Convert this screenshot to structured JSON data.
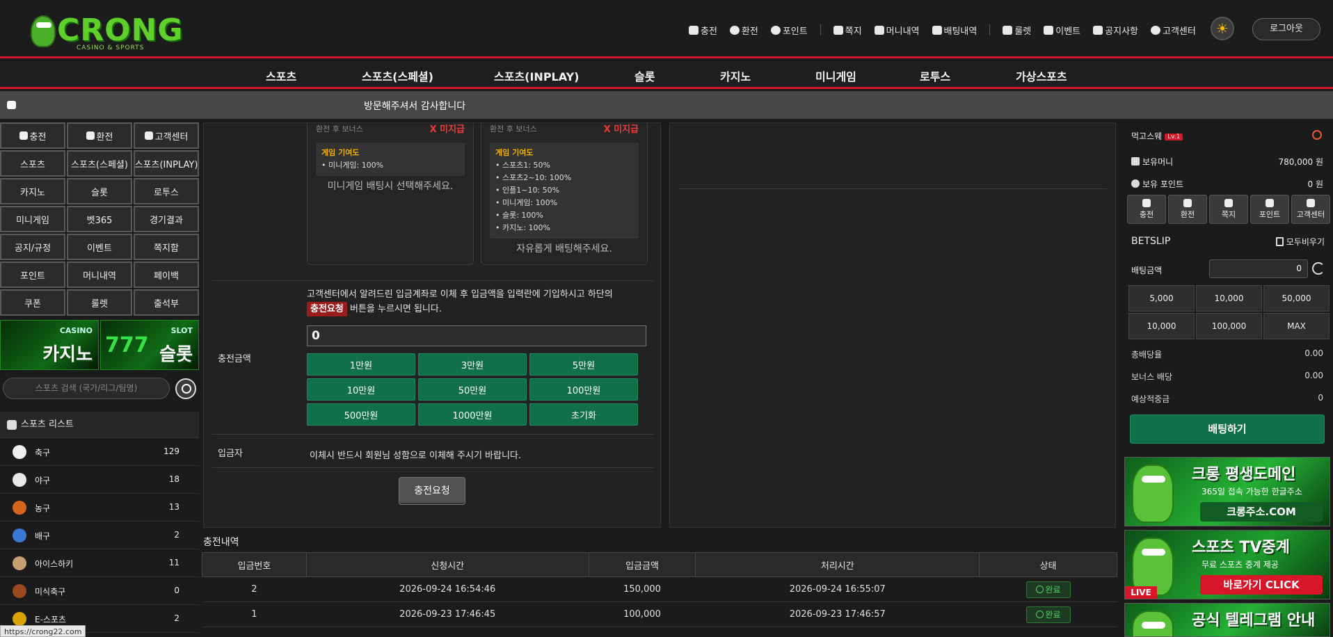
{
  "header": {
    "logo_word": "CRONG",
    "logo_sub": "CASINO & SPORTS",
    "top_links": [
      "충전",
      "환전",
      "포인트",
      "쪽지",
      "머니내역",
      "배팅내역",
      "룰렛",
      "이벤트",
      "공지사항",
      "고객센터"
    ],
    "logout_label": "로그아웃"
  },
  "main_nav": [
    "스포츠",
    "스포츠(스페셜)",
    "스포츠(INPLAY)",
    "슬롯",
    "카지노",
    "미니게임",
    "로투스",
    "가상스포츠"
  ],
  "ticker": "방문해주셔서 감사합니다",
  "left": {
    "quick": [
      "충전",
      "환전",
      "고객센터",
      "스포츠",
      "스포츠(스페셜)",
      "스포츠(INPLAY)",
      "카지노",
      "슬롯",
      "로투스",
      "미니게임",
      "벳365",
      "경기결과",
      "공지/규정",
      "이벤트",
      "쪽지함",
      "포인트",
      "머니내역",
      "페이백",
      "쿠폰",
      "룰렛",
      "출석부"
    ],
    "banner_casino_cap": "CASINO",
    "banner_casino_big": "카지노",
    "banner_slot_cap": "SLOT",
    "banner_slot_big": "슬롯",
    "banner_slot_num": "777",
    "search_placeholder": "스포츠 검색 (국가/리그/팀명)",
    "sports_title": "스포츠 리스트",
    "sports": [
      {
        "name": "축구",
        "count": "129",
        "color": "#f0f0f0"
      },
      {
        "name": "야구",
        "count": "18",
        "color": "#e8e8e8"
      },
      {
        "name": "농구",
        "count": "13",
        "color": "#d4661c"
      },
      {
        "name": "배구",
        "count": "2",
        "color": "#3a78d6"
      },
      {
        "name": "아이스하키",
        "count": "11",
        "color": "#c8a070"
      },
      {
        "name": "미식축구",
        "count": "0",
        "color": "#9a4a20"
      },
      {
        "name": "E-스포츠",
        "count": "2",
        "color": "#d9a400"
      }
    ]
  },
  "deposit": {
    "card1": {
      "head": "환전 후 보너스",
      "status": "X 미지급",
      "box_title": "게임 기여도",
      "lines": [
        "• 미니게임: 100%"
      ],
      "note": "미니게임 배팅시 선택해주세요."
    },
    "card2": {
      "head": "환전 후 보너스",
      "status": "X 미지급",
      "box_title": "게임 기여도",
      "lines": [
        "• 스포츠1: 50%",
        "• 스포츠2~10: 100%",
        "• 인플1~10: 50%",
        "• 미니게임: 100%",
        "• 슬롯: 100%",
        "• 카지노: 100%"
      ],
      "note": "자유롭게 배팅해주세요."
    },
    "desc_before": "고객센터에서 알려드린 입금계좌로 이체 후 입금액을 입력란에 기입하시고 하단의",
    "desc_tag": "충전요청",
    "desc_after": "버튼을 누르시면 됩니다.",
    "amount_label": "충전금액",
    "amount_value": "0",
    "amount_buttons": [
      "1만원",
      "3만원",
      "5만원",
      "10만원",
      "50만원",
      "100만원",
      "500만원",
      "1000만원",
      "초기화"
    ],
    "depositor_label": "입금자",
    "depositor_text": "이체시 반드시 회원님 성함으로 이체해 주시기 바랍니다.",
    "request_label": "충전요청"
  },
  "history": {
    "title": "충전내역",
    "columns": [
      "입금번호",
      "신청시간",
      "입금금액",
      "처리시간",
      "상태"
    ],
    "rows": [
      [
        "2",
        "2026-09-24 16:54:46",
        "150,000",
        "2026-09-24 16:55:07",
        "완료"
      ],
      [
        "1",
        "2026-09-23 17:46:45",
        "100,000",
        "2026-09-23 17:46:57",
        "완료"
      ]
    ]
  },
  "right": {
    "username": "먹고스웨",
    "level": "Lv.1",
    "money_label": "보유머니",
    "money_value": "780,000 원",
    "point_label": "보유 포인트",
    "point_value": "0 원",
    "quick": [
      "충전",
      "환전",
      "쪽지",
      "포인트",
      "고객센터"
    ],
    "betslip": "BETSLIP",
    "clear_all": "모두비우기",
    "bet_amount_label": "배팅금액",
    "bet_amount_value": "0",
    "chips": [
      "5,000",
      "10,000",
      "50,000",
      "10,000",
      "100,000",
      "MAX"
    ],
    "total_odds_label": "총배당율",
    "total_odds_value": "0.00",
    "bonus_odds_label": "보너스 배당",
    "bonus_odds_value": "0.00",
    "expected_label": "예상적중금",
    "expected_value": "0",
    "bet_button": "배팅하기",
    "ad1_head": "크롱 평생도메인",
    "ad1_sub": "365일 접속 가능한 한글주소",
    "ad1_pill": "크롱주소.COM",
    "ad2_head": "스포츠 TV중계",
    "ad2_sub": "무료 스포츠 중계 제공",
    "ad2_pill": "바로가기 CLICK",
    "ad2_live": "LIVE",
    "ad3_head": "공식 텔레그램 안내"
  },
  "status_url": "https://crong22.com"
}
